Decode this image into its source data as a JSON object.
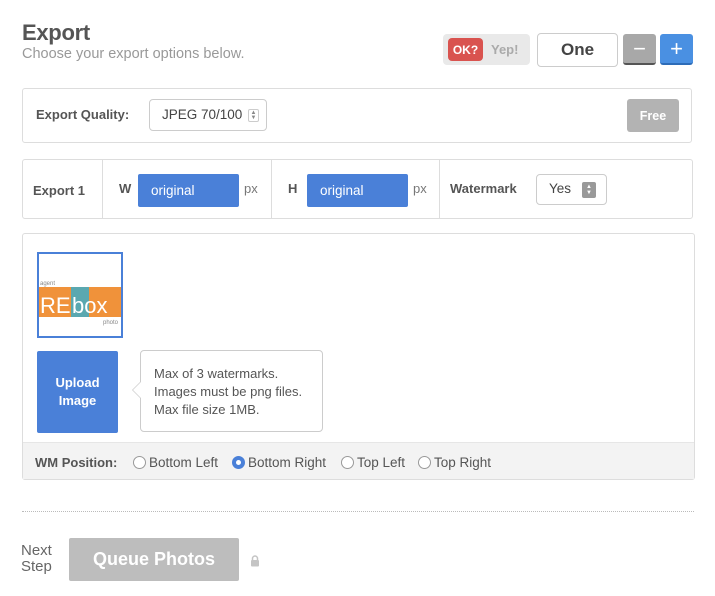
{
  "header": {
    "title": "Export",
    "subtitle": "Choose your export options below."
  },
  "toggle": {
    "ok_label": "OK?",
    "yep_label": "Yep!"
  },
  "count": {
    "value": "One",
    "minus_label": "−",
    "plus_label": "+"
  },
  "quality": {
    "label": "Export Quality:",
    "selected": "JPEG 70/100",
    "free_label": "Free"
  },
  "export_row": {
    "label": "Export 1",
    "width_label": "W",
    "width_value": "original",
    "height_label": "H",
    "height_value": "original",
    "unit": "px",
    "watermark_label": "Watermark",
    "watermark_value": "Yes"
  },
  "watermark": {
    "logo": {
      "top_text": "agent",
      "brand_left": "RE",
      "brand_right": "box",
      "bottom_text": "photo",
      "colors": {
        "orange": "#f0923a",
        "teal": "#5aa8b0"
      }
    },
    "upload_line1": "Upload",
    "upload_line2": "Image",
    "info_lines": [
      "Max of 3 watermarks.",
      "Images must be png files.",
      "Max file size 1MB."
    ],
    "position_label": "WM Position:",
    "positions": [
      {
        "label": "Bottom Left",
        "checked": false
      },
      {
        "label": "Bottom Right",
        "checked": true
      },
      {
        "label": "Top Left",
        "checked": false
      },
      {
        "label": "Top Right",
        "checked": false
      }
    ]
  },
  "footer": {
    "next_line1": "Next",
    "next_line2": "Step",
    "queue_label": "Queue Photos"
  },
  "colors": {
    "accent_blue": "#4a80d8",
    "danger_red": "#d9534f",
    "disabled_gray": "#bdbdbd"
  }
}
